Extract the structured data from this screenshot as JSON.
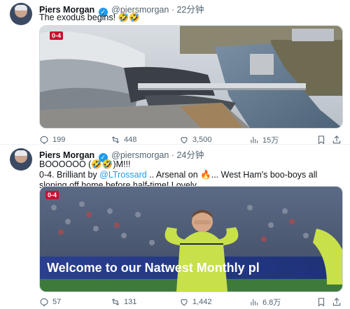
{
  "tweets": [
    {
      "author": "Piers Morgan",
      "handle": "@piersmorgan",
      "time": "· 22分钟",
      "text": "The exodus begins! 🤣🤣",
      "score": "0-4",
      "actions": {
        "replies": "199",
        "reposts": "448",
        "likes": "3,500",
        "views": "15万"
      }
    },
    {
      "author": "Piers Morgan",
      "handle": "@piersmorgan",
      "time": "· 24分钟",
      "text_before": "BOOOOOO (🤣🤣)M!!!\n0-4. Brilliant by ",
      "mention": "@LTrossard",
      "text_after": " .. Arsenal on 🔥... West Ham's boo-boys all sloping off home before half-time! Lovely.",
      "score": "0-4",
      "banner": "Welcome to our Natwest Monthly pl",
      "actions": {
        "replies": "57",
        "reposts": "131",
        "likes": "1,442",
        "views": "6.8万"
      }
    }
  ]
}
